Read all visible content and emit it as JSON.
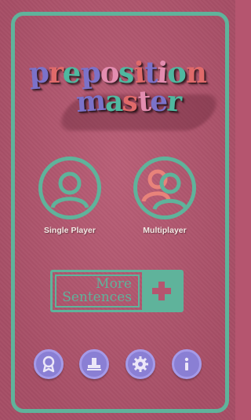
{
  "logo": {
    "line1": "preposition",
    "line2": "master",
    "line1_colors": [
      "#7b72c9",
      "#e06a6a",
      "#4fb8a0",
      "#7b72c9",
      "#e38db0",
      "#4fb8a0",
      "#e06a6a",
      "#7b72c9",
      "#e38db0",
      "#4fb8a0",
      "#e06a6a"
    ],
    "line2_colors": [
      "#7b72c9",
      "#4fb8a0",
      "#e06a6a",
      "#e38db0",
      "#7b72c9",
      "#4fb8a0"
    ]
  },
  "buttons": {
    "single_player": "Single Player",
    "multiplayer": "Multiplayer",
    "more_line1": "More",
    "more_line2": "Sentences"
  },
  "toolbar": {
    "icons": [
      "award-icon",
      "stamp-icon",
      "gear-icon",
      "info-icon"
    ]
  },
  "colors": {
    "background": "#b5556f",
    "accent": "#5fb39b",
    "coral": "#e8837a",
    "round_button": "#8a7fd4"
  }
}
